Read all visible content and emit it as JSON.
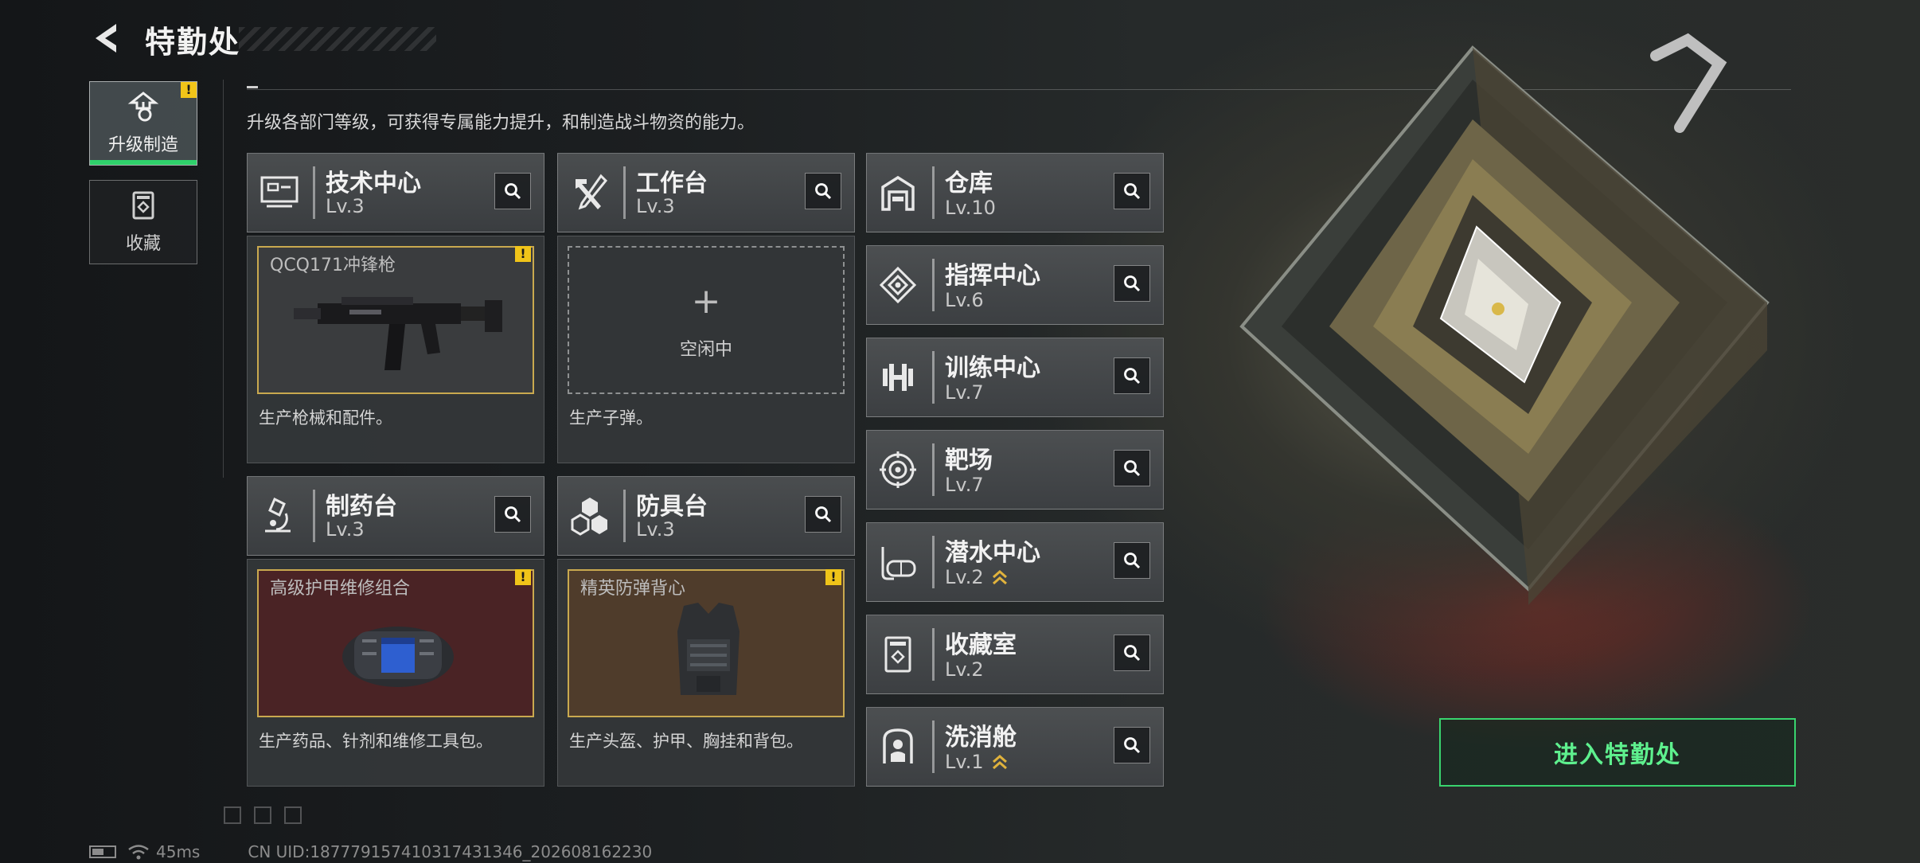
{
  "header": {
    "title": "特勤处",
    "description": "升级各部门等级，可获得专属能力提升，和制造战斗物资的能力。"
  },
  "nav": {
    "items": [
      {
        "label": "升级制造",
        "active": true,
        "badge": "!"
      },
      {
        "label": "收藏",
        "active": false
      }
    ]
  },
  "cards": [
    {
      "name": "技术中心",
      "level": "Lv.3",
      "slot_title": "QCQ171冲锋枪",
      "slot_badge": "!",
      "description": "生产枪械和配件。"
    },
    {
      "name": "工作台",
      "level": "Lv.3",
      "slot_plus": "+",
      "slot_status": "空闲中",
      "description": "生产子弹。"
    },
    {
      "name": "制药台",
      "level": "Lv.3",
      "slot_title": "高级护甲维修组合",
      "slot_badge": "!",
      "description": "生产药品、针剂和维修工具包。"
    },
    {
      "name": "防具台",
      "level": "Lv.3",
      "slot_title": "精英防弹背心",
      "slot_badge": "!",
      "description": "生产头盔、护甲、胸挂和背包。"
    }
  ],
  "facilities": [
    {
      "name": "仓库",
      "level": "Lv.10",
      "icon": "warehouse-icon"
    },
    {
      "name": "指挥中心",
      "level": "Lv.6",
      "icon": "command-icon"
    },
    {
      "name": "训练中心",
      "level": "Lv.7",
      "icon": "dumbbell-icon"
    },
    {
      "name": "靶场",
      "level": "Lv.7",
      "icon": "target-icon"
    },
    {
      "name": "潜水中心",
      "level": "Lv.2",
      "icon": "diving-mask-icon",
      "upgrade": true
    },
    {
      "name": "收藏室",
      "level": "Lv.2",
      "icon": "collection-icon"
    },
    {
      "name": "洗消舱",
      "level": "Lv.1",
      "icon": "decontamination-icon",
      "upgrade": true
    }
  ],
  "enter_button": {
    "label": "进入特勤处"
  },
  "footer": {
    "ping": "45ms",
    "uid": "CN UID:18777915741031​7431346_202608162230"
  },
  "colors": {
    "accent_green": "#39d46e",
    "badge_yellow": "#f0c419",
    "gold_border": "#c9a94f",
    "red_slot": "#4a2325",
    "brown_slot": "#4f3c2b"
  }
}
